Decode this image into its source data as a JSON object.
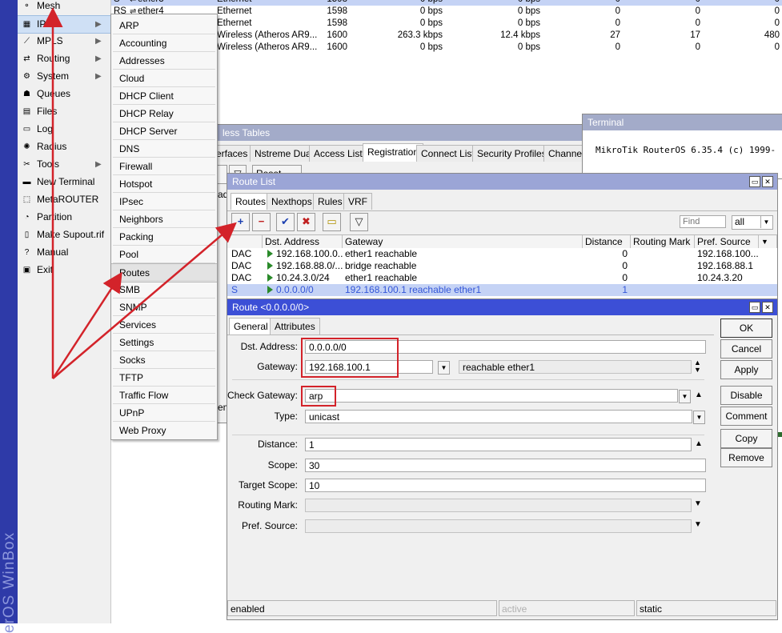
{
  "brand": {
    "text": "erOS WinBox"
  },
  "left_menu": {
    "items": [
      {
        "label": "Mesh",
        "icon": "mesh-icon",
        "arrow": false
      },
      {
        "label": "IP",
        "icon": "ip-icon",
        "arrow": true
      },
      {
        "label": "MPLS",
        "icon": "mpls-icon",
        "arrow": true
      },
      {
        "label": "Routing",
        "icon": "routing-icon",
        "arrow": true
      },
      {
        "label": "System",
        "icon": "system-icon",
        "arrow": true
      },
      {
        "label": "Queues",
        "icon": "queues-icon",
        "arrow": false
      },
      {
        "label": "Files",
        "icon": "files-icon",
        "arrow": false
      },
      {
        "label": "Log",
        "icon": "log-icon",
        "arrow": false
      },
      {
        "label": "Radius",
        "icon": "radius-icon",
        "arrow": false
      },
      {
        "label": "Tools",
        "icon": "tools-icon",
        "arrow": true
      },
      {
        "label": "New Terminal",
        "icon": "terminal-icon",
        "arrow": false
      },
      {
        "label": "MetaROUTER",
        "icon": "metarouter-icon",
        "arrow": false
      },
      {
        "label": "Partition",
        "icon": "partition-icon",
        "arrow": false
      },
      {
        "label": "Make Supout.rif",
        "icon": "supout-icon",
        "arrow": false
      },
      {
        "label": "Manual",
        "icon": "manual-icon",
        "arrow": false
      },
      {
        "label": "Exit",
        "icon": "exit-icon",
        "arrow": false
      }
    ]
  },
  "ip_submenu": {
    "items": [
      "ARP",
      "Accounting",
      "Addresses",
      "Cloud",
      "DHCP Client",
      "DHCP Relay",
      "DHCP Server",
      "DNS",
      "Firewall",
      "Hotspot",
      "IPsec",
      "Neighbors",
      "Packing",
      "Pool",
      "Routes",
      "SMB",
      "SNMP",
      "Services",
      "Settings",
      "Socks",
      "TFTP",
      "Traffic Flow",
      "UPnP",
      "Web Proxy"
    ],
    "selected": "Routes"
  },
  "interface_table": {
    "rows": [
      {
        "flags": "S",
        "name": "ether3",
        "type": "Ethernet",
        "mtu": "1598",
        "tx": "0 bps",
        "rx": "0 bps",
        "c1": "0",
        "c2": "0",
        "c3": "0"
      },
      {
        "flags": "RS",
        "name": "ether4",
        "type": "Ethernet",
        "mtu": "1598",
        "tx": "0 bps",
        "rx": "0 bps",
        "c1": "0",
        "c2": "0",
        "c3": "0"
      },
      {
        "flags": "",
        "name": "",
        "type": "Ethernet",
        "mtu": "1598",
        "tx": "0 bps",
        "rx": "0 bps",
        "c1": "0",
        "c2": "0",
        "c3": "0"
      },
      {
        "flags": "",
        "name": "",
        "type": "Wireless (Atheros AR9...",
        "mtu": "1600",
        "tx": "263.3 kbps",
        "rx": "12.4 kbps",
        "c1": "27",
        "c2": "17",
        "c3": "480"
      },
      {
        "flags": "",
        "name": "",
        "type": "Wireless (Atheros AR9...",
        "mtu": "1600",
        "tx": "0 bps",
        "rx": "0 bps",
        "c1": "0",
        "c2": "0",
        "c3": "0"
      }
    ]
  },
  "wireless_window": {
    "title": "less Tables",
    "tabs": [
      "erfaces",
      "Nstreme Dual",
      "Access List",
      "Registration",
      "Connect List",
      "Security Profiles",
      "Channels"
    ],
    "active_tab": "Registration",
    "reset_label": "Reset",
    "fragment_a": "adi",
    "fragment_b": "em"
  },
  "terminal_window": {
    "title": "Terminal",
    "line": "MikroTik RouterOS 6.35.4 (c) 1999-"
  },
  "route_list": {
    "title": "Route List",
    "tabs": [
      "Routes",
      "Nexthops",
      "Rules",
      "VRF"
    ],
    "active_tab": "Routes",
    "find_placeholder": "Find",
    "filter_value": "all",
    "columns": [
      "Dst. Address",
      "Gateway",
      "Distance",
      "Routing Mark",
      "Pref. Source"
    ],
    "rows": [
      {
        "flags": "DAC",
        "dst": "192.168.100.0...",
        "gateway": "ether1 reachable",
        "distance": "0",
        "mark": "",
        "pref": "192.168.100...."
      },
      {
        "flags": "DAC",
        "dst": "192.168.88.0/...",
        "gateway": "bridge reachable",
        "distance": "0",
        "mark": "",
        "pref": "192.168.88.1"
      },
      {
        "flags": "DAC",
        "dst": "10.24.3.0/24",
        "gateway": "ether1 reachable",
        "distance": "0",
        "mark": "",
        "pref": "10.24.3.20"
      },
      {
        "flags": "S",
        "dst": "0.0.0.0/0",
        "gateway": "192.168.100.1 reachable ether1",
        "distance": "1",
        "mark": "",
        "pref": ""
      }
    ]
  },
  "route_dialog": {
    "title": "Route <0.0.0.0/0>",
    "tabs": [
      "General",
      "Attributes"
    ],
    "active_tab": "General",
    "labels": {
      "dst": "Dst. Address:",
      "gateway": "Gateway:",
      "check_gateway": "Check Gateway:",
      "type": "Type:",
      "distance": "Distance:",
      "scope": "Scope:",
      "target_scope": "Target Scope:",
      "routing_mark": "Routing Mark:",
      "pref_source": "Pref. Source:"
    },
    "values": {
      "dst": "0.0.0.0/0",
      "gateway": "192.168.100.1",
      "gateway_status": "reachable ether1",
      "check_gateway": "arp",
      "type": "unicast",
      "distance": "1",
      "scope": "30",
      "target_scope": "10",
      "routing_mark": "",
      "pref_source": ""
    },
    "buttons": [
      "OK",
      "Cancel",
      "Apply",
      "Disable",
      "Comment",
      "Copy",
      "Remove"
    ],
    "status": {
      "state": "enabled",
      "active": "active",
      "kind": "static"
    }
  },
  "colors": {
    "annotation_red": "#d3232a",
    "title_blue": "#3c4fd6",
    "selection_blue": "#c5d3f5"
  }
}
